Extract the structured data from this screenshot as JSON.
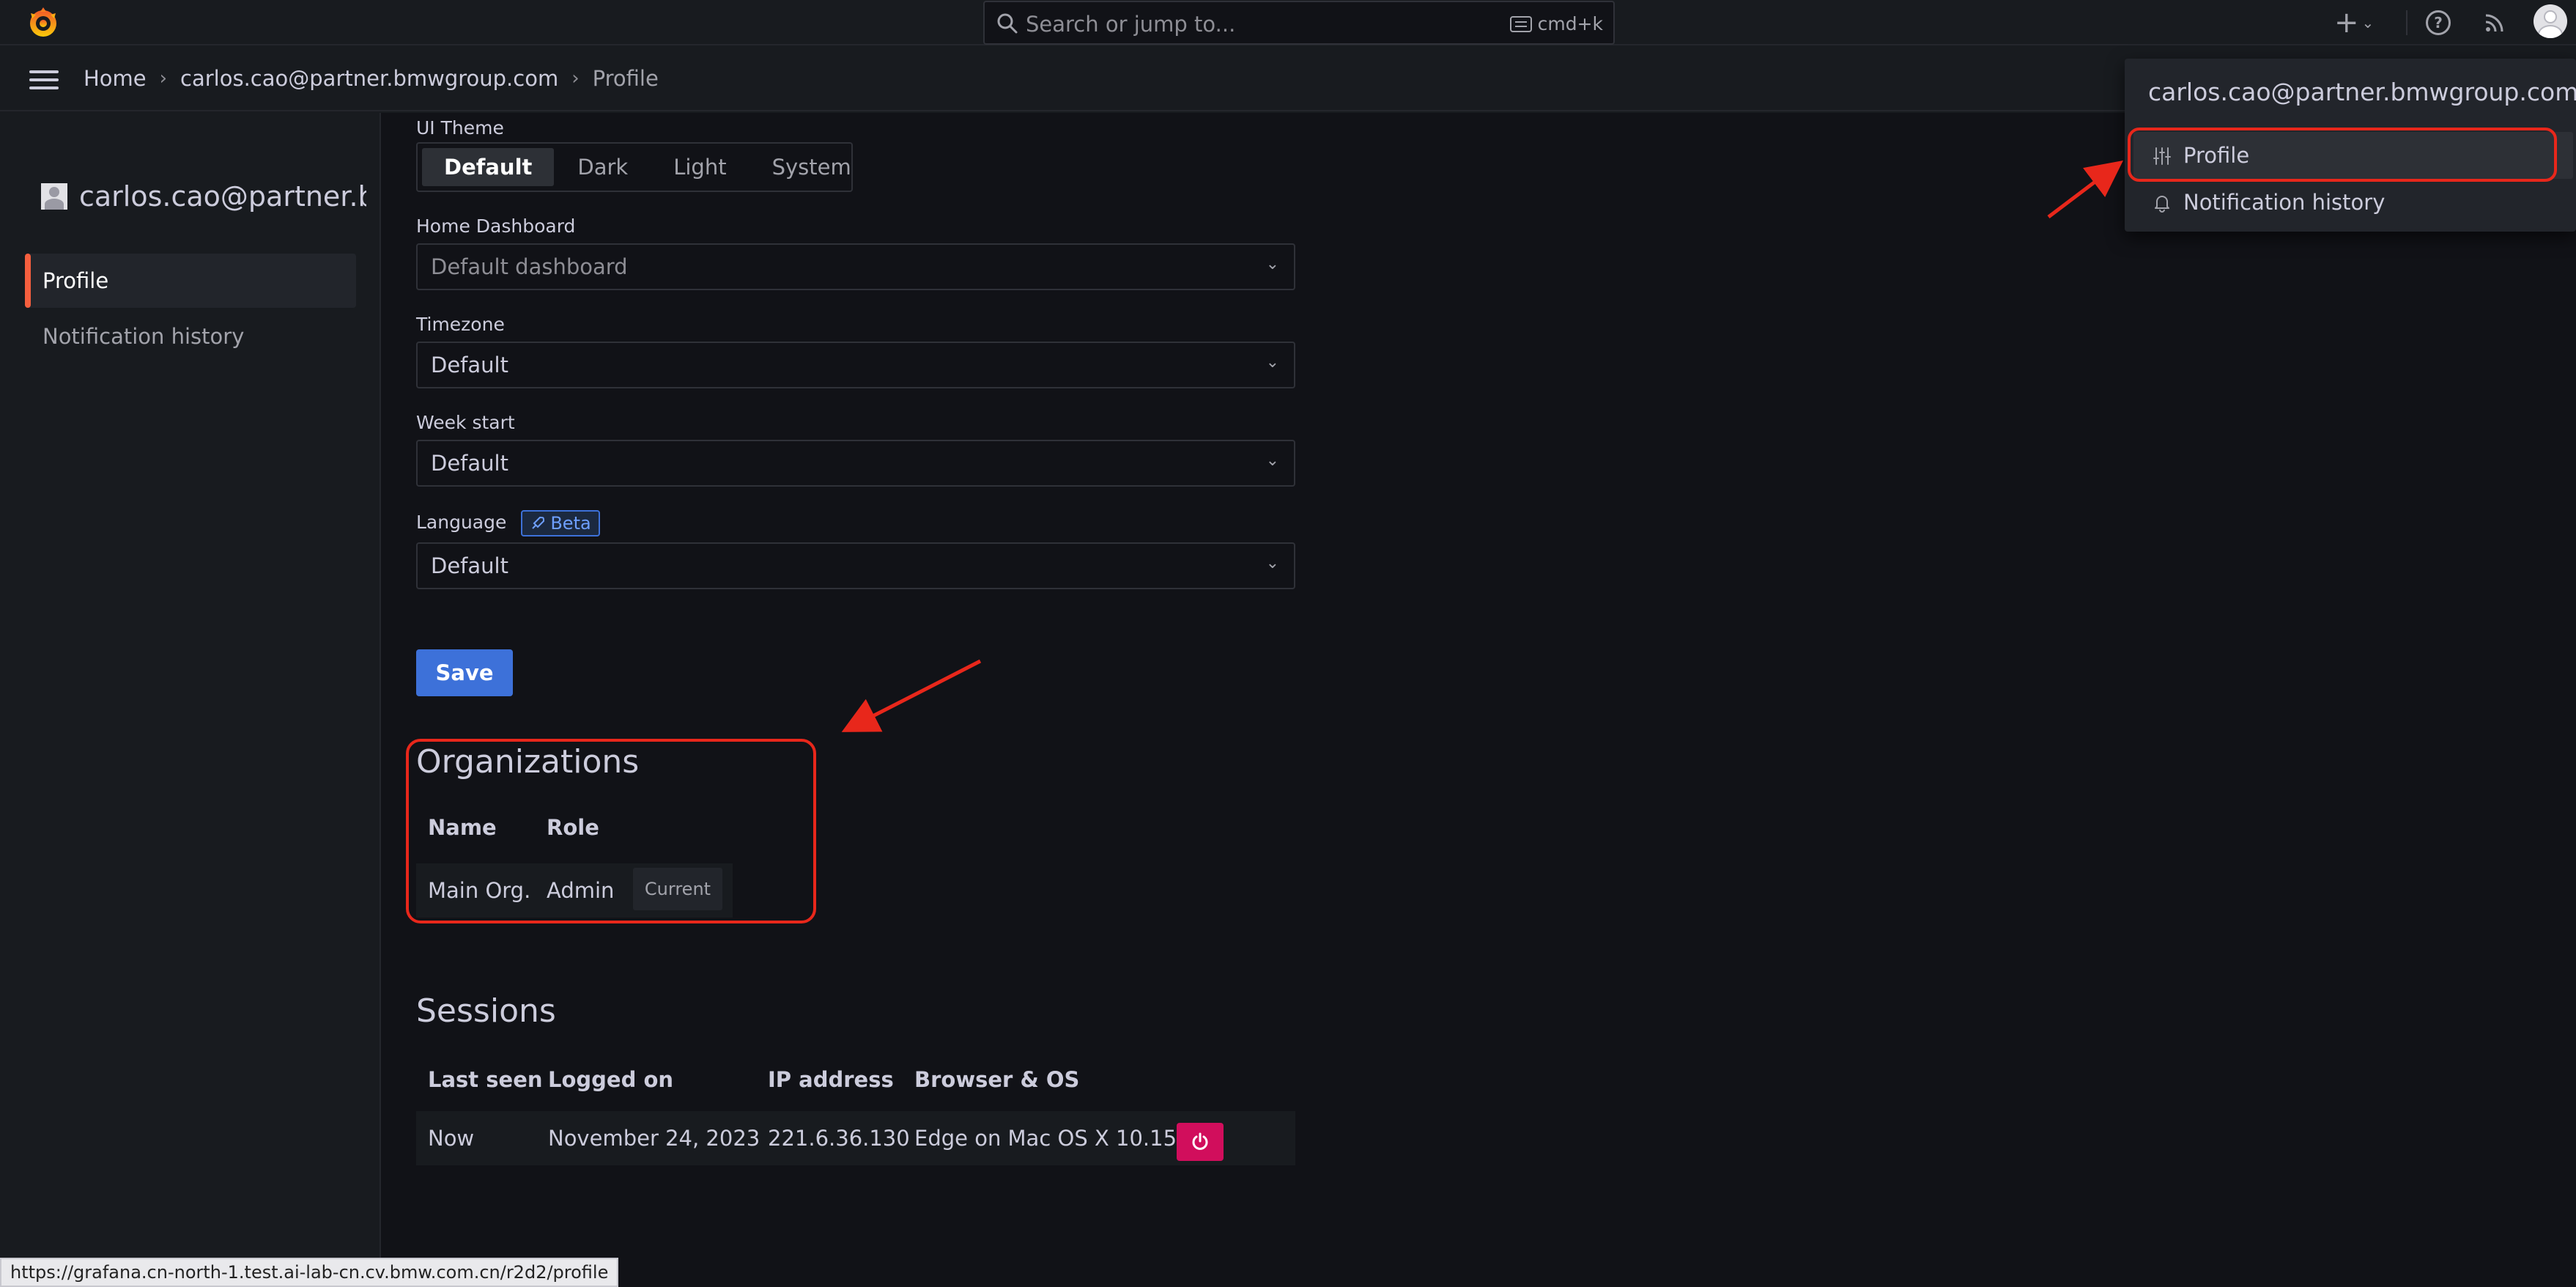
{
  "topbar": {
    "search_placeholder": "Search or jump to...",
    "search_shortcut": "cmd+k",
    "plus_icon": "plus-icon",
    "help_icon": "help-icon",
    "news_icon": "rss-icon",
    "accent_color": "#f55f3e"
  },
  "breadcrumb": {
    "home": "Home",
    "user": "carlos.cao@partner.bmwgroup.com",
    "current": "Profile"
  },
  "sidebar": {
    "user_name": "carlos.cao@partner.bmwgroup.com",
    "items": [
      {
        "label": "Profile",
        "active": true
      },
      {
        "label": "Notification history",
        "active": false
      }
    ]
  },
  "preferences": {
    "ui_theme_label": "UI Theme",
    "ui_theme_options": [
      "Default",
      "Dark",
      "Light",
      "System"
    ],
    "ui_theme_selected": "Default",
    "home_dashboard_label": "Home Dashboard",
    "home_dashboard_value": "Default dashboard",
    "timezone_label": "Timezone",
    "timezone_value": "Default",
    "week_start_label": "Week start",
    "week_start_value": "Default",
    "language_label": "Language",
    "language_badge": "Beta",
    "language_value": "Default",
    "save_label": "Save"
  },
  "organizations": {
    "title": "Organizations",
    "columns": [
      "Name",
      "Role"
    ],
    "rows": [
      {
        "name": "Main Org.",
        "role": "Admin",
        "tag": "Current"
      }
    ]
  },
  "sessions": {
    "title": "Sessions",
    "columns": [
      "Last seen",
      "Logged on",
      "IP address",
      "Browser & OS"
    ],
    "rows": [
      {
        "last_seen": "Now",
        "logged_on": "November 24, 2023",
        "ip": "221.6.36.130",
        "browser_os": "Edge on Mac OS X 10.15"
      }
    ],
    "revoke_color": "#d10e5c"
  },
  "user_menu": {
    "title": "carlos.cao@partner.bmwgroup.com",
    "items": [
      {
        "label": "Profile",
        "icon": "sliders-icon"
      },
      {
        "label": "Notification history",
        "icon": "bell-icon"
      }
    ]
  },
  "annotations": {
    "color": "#e8271b"
  },
  "status_bar": {
    "url": "https://grafana.cn-north-1.test.ai-lab-cn.cv.bmw.com.cn/r2d2/profile"
  }
}
